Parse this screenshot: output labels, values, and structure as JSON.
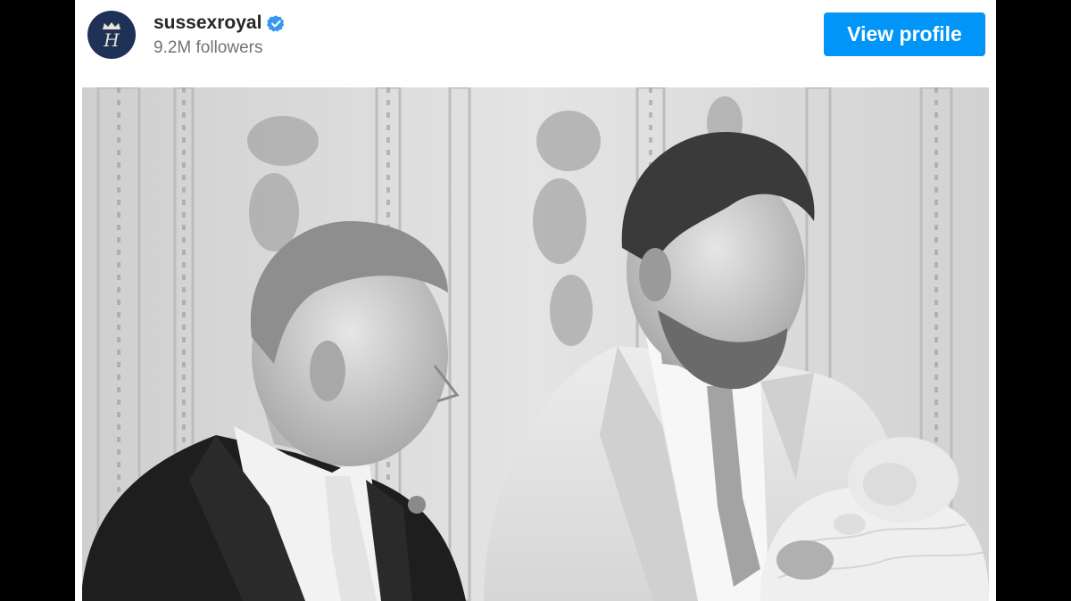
{
  "post": {
    "account": {
      "handle": "sussexroyal",
      "verified": true,
      "followers": "9.2M followers",
      "avatar_monogram": "H",
      "avatar_icon": "crown-monogram-icon"
    },
    "view_profile_label": "View profile",
    "photo": {
      "style": "black-and-white",
      "subject": "three-people-portrait"
    }
  },
  "colors": {
    "button": "#0095f6",
    "verified_badge": "#3897f0",
    "avatar_bg": "#1f3157",
    "frame": "#000000"
  }
}
